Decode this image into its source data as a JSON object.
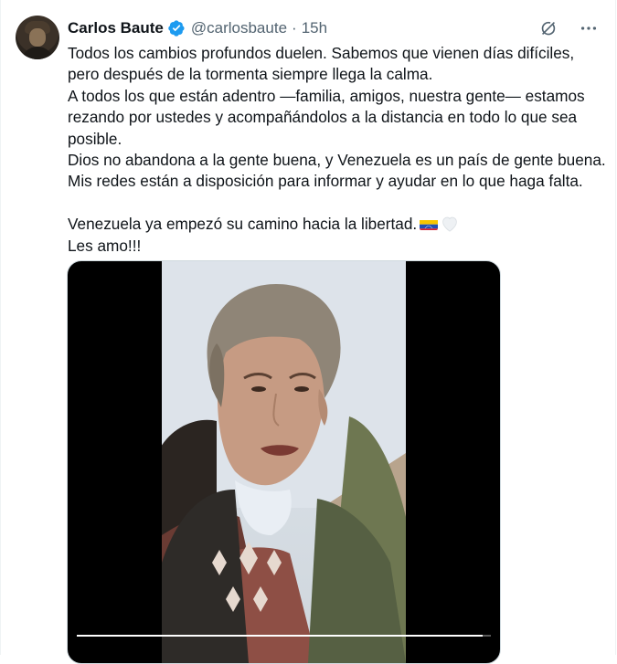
{
  "tweet": {
    "author_name": "Carlos Baute",
    "handle": "@carlosbaute",
    "separator": "·",
    "time": "15h",
    "paragraphs": [
      "Todos los cambios profundos duelen. Sabemos que vienen días difíciles, pero después de la tormenta siempre llega la calma.",
      "A todos los que están adentro —familia, amigos, nuestra gente— estamos rezando por ustedes y acompañándolos a la distancia en todo lo que sea posible.",
      "Dios no abandona a la gente buena, y Venezuela es un país de gente buena.",
      "Mis redes están a disposición para informar y ayudar en lo que haga falta."
    ],
    "closing_line_1": "Venezuela ya empezó su camino hacia la libertad.",
    "closing_line_2": "Les amo!!!"
  },
  "icons": {
    "verified": "verified-badge-icon",
    "grok": "grok-icon",
    "more": "more-icon",
    "flag": "venezuela-flag-emoji",
    "heart": "white-heart-emoji"
  },
  "media": {
    "type": "video",
    "progress": 0.98
  },
  "colors": {
    "text": "#0f1419",
    "secondary": "#536471",
    "verified": "#1d9bf0",
    "border": "#eff3f4"
  }
}
